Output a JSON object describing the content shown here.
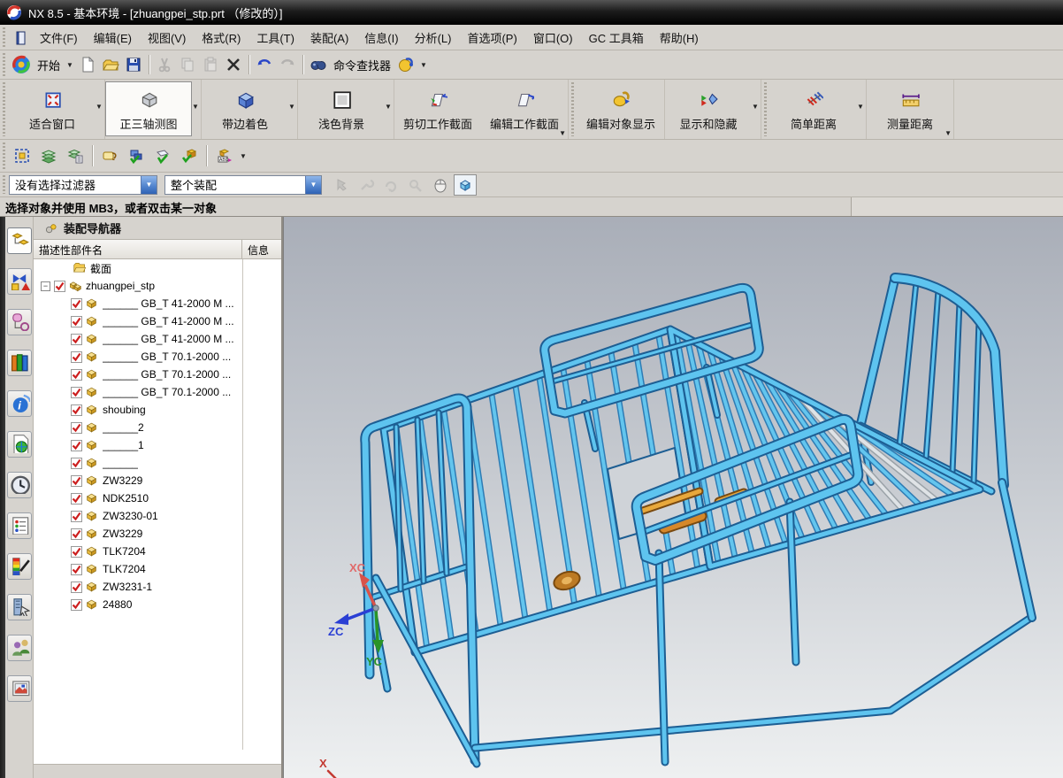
{
  "window": {
    "title": "NX 8.5 - 基本环境 - [zhuangpei_stp.prt （修改的）]"
  },
  "menubar": {
    "items": [
      "文件(F)",
      "编辑(E)",
      "视图(V)",
      "格式(R)",
      "工具(T)",
      "装配(A)",
      "信息(I)",
      "分析(L)",
      "首选项(P)",
      "窗口(O)",
      "GC 工具箱",
      "帮助(H)"
    ]
  },
  "standard_toolbar": {
    "start_label": "开始",
    "buttons": [
      {
        "name": "new-button",
        "icon": "new-doc-icon"
      },
      {
        "name": "open-button",
        "icon": "open-folder-icon"
      },
      {
        "name": "save-button",
        "icon": "save-icon"
      },
      {
        "sep": true
      },
      {
        "name": "cut-button",
        "icon": "cut-icon",
        "disabled": true
      },
      {
        "name": "copy-button",
        "icon": "copy-icon",
        "disabled": true
      },
      {
        "name": "paste-button",
        "icon": "paste-icon",
        "disabled": true
      },
      {
        "name": "delete-button",
        "icon": "delete-icon"
      },
      {
        "sep": true
      },
      {
        "name": "undo-button",
        "icon": "undo-icon"
      },
      {
        "name": "redo-button",
        "icon": "redo-icon",
        "disabled": true
      },
      {
        "sep": true
      }
    ],
    "command_finder_label": "命令查找器"
  },
  "view_toolbar": {
    "groups": [
      {
        "grip": true,
        "buttons": [
          {
            "label": "适合窗口",
            "icon": "fit-window-icon",
            "arrow": true
          }
        ]
      },
      {
        "buttons": [
          {
            "label": "正三轴测图",
            "icon": "trimetric-view-icon",
            "arrow": true,
            "pressed": true
          }
        ]
      },
      {
        "buttons": [
          {
            "label": "带边着色",
            "icon": "shaded-edges-icon",
            "arrow": true
          }
        ]
      },
      {
        "buttons": [
          {
            "label": "浅色背景",
            "icon": "light-background-icon",
            "arrow": true
          }
        ]
      },
      {
        "buttons": [
          {
            "label": "剪切工作截面",
            "icon": "clip-section-icon"
          },
          {
            "label": "编辑工作截面",
            "icon": "edit-section-icon"
          }
        ],
        "overflow": true
      },
      {
        "grip": true,
        "buttons": [
          {
            "label": "编辑对象显示",
            "icon": "edit-object-display-icon"
          }
        ]
      },
      {
        "buttons": [
          {
            "label": "显示和隐藏",
            "icon": "show-hide-icon",
            "arrow": true
          }
        ]
      },
      {
        "grip": true,
        "buttons": [
          {
            "label": "简单距离",
            "icon": "simple-distance-icon",
            "arrow": true
          }
        ]
      },
      {
        "buttons": [
          {
            "label": "测量距离",
            "icon": "measure-distance-icon"
          }
        ],
        "overflow": true
      }
    ]
  },
  "utility_toolbar": {
    "buttons": [
      {
        "name": "marquee-select-button",
        "icon": "marquee-select-icon"
      },
      {
        "name": "layers-button",
        "icon": "layers-icon"
      },
      {
        "name": "layer-settings-button",
        "icon": "layer-settings-icon"
      },
      {
        "sep": true
      },
      {
        "name": "tag-note-button",
        "icon": "tag-note-icon"
      },
      {
        "name": "assembly-check-button",
        "icon": "block-check-icon"
      },
      {
        "name": "sketch-check-button",
        "icon": "sketch-check-icon"
      },
      {
        "name": "cube-check-button",
        "icon": "cube-check-icon"
      },
      {
        "sep": true
      },
      {
        "name": "abc-label-button",
        "icon": "abc-cube-icon",
        "arrow": true
      }
    ]
  },
  "selection_bar": {
    "filter_value": "没有选择过滤器",
    "scope_value": "整个装配",
    "tools": [
      {
        "name": "snap-point-button",
        "icon": "gray-hand-icon",
        "disabled": true
      },
      {
        "name": "select-tool-1",
        "icon": "gray-wrench-icon",
        "disabled": true
      },
      {
        "name": "select-tool-2",
        "icon": "gray-rotate-icon",
        "disabled": true
      },
      {
        "name": "select-tool-3",
        "icon": "gray-grab-icon",
        "disabled": true
      },
      {
        "name": "mouse-mode-button",
        "icon": "mouse-icon"
      },
      {
        "name": "shaded-cube-button",
        "icon": "wire-cube-icon",
        "pressed": true
      }
    ]
  },
  "prompt_bar": {
    "text": "选择对象并使用 MB3，或者双击某一对象"
  },
  "sidebar": {
    "tabs": [
      {
        "name": "assembly-navigator-tab",
        "icon": "assembly-navigator-icon",
        "active": true
      },
      {
        "name": "constraint-navigator-tab",
        "icon": "constraint-navigator-icon"
      },
      {
        "name": "part-navigator-tab",
        "icon": "part-navigator-icon"
      },
      {
        "name": "reuse-library-tab",
        "icon": "reuse-library-icon"
      },
      {
        "name": "internet-explorer-tab",
        "icon": "internet-icon"
      },
      {
        "name": "history-palette-tab",
        "icon": "html-doc-icon"
      },
      {
        "name": "history-tab",
        "icon": "clock-icon"
      },
      {
        "name": "process-studio-tab",
        "icon": "panel-list-icon"
      },
      {
        "name": "materials-tab",
        "icon": "rainbow-wand-icon"
      },
      {
        "name": "system-scene-tab",
        "icon": "tower-cursor-icon"
      },
      {
        "name": "roles-tab",
        "icon": "roles-icon"
      },
      {
        "name": "windows-tab",
        "icon": "window-picture-icon"
      }
    ]
  },
  "navigator": {
    "title": "装配导航器",
    "columns": [
      "描述性部件名",
      "信息"
    ],
    "items": [
      {
        "label": "截面",
        "icon": "folder-icon",
        "kind": "folder"
      },
      {
        "label": "zhuangpei_stp",
        "icon": "assembly-icon",
        "kind": "assembly",
        "checked": true,
        "expander": "-"
      },
      {
        "label": "______ GB_T 41-2000 M ...",
        "icon": "part-icon",
        "kind": "part",
        "checked": true
      },
      {
        "label": "______ GB_T 41-2000 M ...",
        "icon": "part-icon",
        "kind": "part",
        "checked": true
      },
      {
        "label": "______ GB_T 41-2000 M ...",
        "icon": "part-icon",
        "kind": "part",
        "checked": true
      },
      {
        "label": "______ GB_T 70.1-2000 ...",
        "icon": "part-icon",
        "kind": "part",
        "checked": true
      },
      {
        "label": "______ GB_T 70.1-2000 ...",
        "icon": "part-icon",
        "kind": "part",
        "checked": true
      },
      {
        "label": "______ GB_T 70.1-2000 ...",
        "icon": "part-icon",
        "kind": "part",
        "checked": true
      },
      {
        "label": "shoubing",
        "icon": "part-icon",
        "kind": "part",
        "checked": true
      },
      {
        "label": "______2",
        "icon": "part-icon",
        "kind": "part",
        "checked": true
      },
      {
        "label": "______1",
        "icon": "part-icon",
        "kind": "part",
        "checked": true
      },
      {
        "label": "______",
        "icon": "part-icon",
        "kind": "part",
        "checked": true
      },
      {
        "label": "ZW3229",
        "icon": "part-icon",
        "kind": "part",
        "checked": true
      },
      {
        "label": "NDK2510",
        "icon": "part-icon",
        "kind": "part",
        "checked": true
      },
      {
        "label": "ZW3230-01",
        "icon": "part-icon",
        "kind": "part",
        "checked": true
      },
      {
        "label": "ZW3229",
        "icon": "part-icon",
        "kind": "part",
        "checked": true
      },
      {
        "label": "TLK7204",
        "icon": "part-icon",
        "kind": "part",
        "checked": true
      },
      {
        "label": "TLK7204",
        "icon": "part-icon",
        "kind": "part",
        "checked": true
      },
      {
        "label": "ZW3231-1",
        "icon": "part-icon",
        "kind": "part",
        "checked": true
      },
      {
        "label": "24880",
        "icon": "part-icon",
        "kind": "part",
        "checked": true
      }
    ]
  },
  "viewport": {
    "triad": {
      "x_label": "XC",
      "y_label": "YC",
      "z_label": "ZC"
    },
    "bottom_axis_label": "X",
    "colors": {
      "tube_light": "#5ec4ef",
      "tube_mid": "#3e9ed2",
      "tube_dark": "#1d5e93",
      "slat_light": "#63c5ee",
      "slat_dark": "#2e7cb4",
      "white_slat_light": "#dfe3e6",
      "white_slat_dark": "#9aa2a8",
      "mechanism_orange": "#d6882a",
      "mechanism_dark": "#7a4a10",
      "hole_fill": "#cfd3d8",
      "axis_x": "#d9534a",
      "axis_y": "#2a9428",
      "axis_z": "#2a3fd4"
    }
  }
}
